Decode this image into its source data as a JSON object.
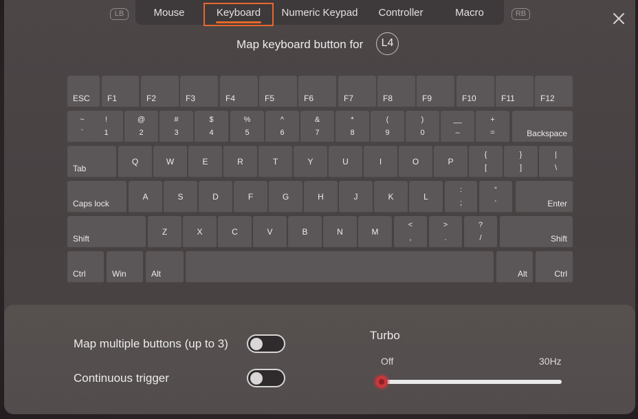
{
  "tabs": {
    "left_bumper": "LB",
    "right_bumper": "RB",
    "items": [
      {
        "label": "Mouse",
        "active": false
      },
      {
        "label": "Keyboard",
        "active": true
      },
      {
        "label": "Numeric Keypad",
        "active": false
      },
      {
        "label": "Controller",
        "active": false
      },
      {
        "label": "Macro",
        "active": false
      }
    ]
  },
  "header": {
    "title": "Map keyboard button for",
    "target_button": "L4"
  },
  "keyboard": {
    "rows": [
      [
        {
          "id": "esc",
          "label": "ESC"
        },
        {
          "id": "f1",
          "label": "F1"
        },
        {
          "id": "f2",
          "label": "F2"
        },
        {
          "id": "f3",
          "label": "F3"
        },
        {
          "id": "f4",
          "label": "F4"
        },
        {
          "id": "f5",
          "label": "F5"
        },
        {
          "id": "f6",
          "label": "F6"
        },
        {
          "id": "f7",
          "label": "F7"
        },
        {
          "id": "f8",
          "label": "F8"
        },
        {
          "id": "f9",
          "label": "F9"
        },
        {
          "id": "f10",
          "label": "F10"
        },
        {
          "id": "f11",
          "label": "F11"
        },
        {
          "id": "f12",
          "label": "F12"
        }
      ],
      [
        {
          "id": "grave",
          "top": "~",
          "bottom": "`"
        },
        {
          "id": "1",
          "top": "!",
          "bottom": "1"
        },
        {
          "id": "2",
          "top": "@",
          "bottom": "2"
        },
        {
          "id": "3",
          "top": "#",
          "bottom": "3"
        },
        {
          "id": "4",
          "top": "$",
          "bottom": "4"
        },
        {
          "id": "5",
          "top": "%",
          "bottom": "5"
        },
        {
          "id": "6",
          "top": "^",
          "bottom": "6"
        },
        {
          "id": "7",
          "top": "&",
          "bottom": "7"
        },
        {
          "id": "8",
          "top": "*",
          "bottom": "8"
        },
        {
          "id": "9",
          "top": "(",
          "bottom": "9"
        },
        {
          "id": "0",
          "top": ")",
          "bottom": "0"
        },
        {
          "id": "minus",
          "top": "__",
          "bottom": "–"
        },
        {
          "id": "equals",
          "top": "+",
          "bottom": "="
        },
        {
          "id": "backspace",
          "label": "Backspace"
        }
      ],
      [
        {
          "id": "tab",
          "label": "Tab"
        },
        {
          "id": "q",
          "label": "Q"
        },
        {
          "id": "w",
          "label": "W"
        },
        {
          "id": "e",
          "label": "E"
        },
        {
          "id": "r",
          "label": "R"
        },
        {
          "id": "t",
          "label": "T"
        },
        {
          "id": "y",
          "label": "Y"
        },
        {
          "id": "u",
          "label": "U"
        },
        {
          "id": "i",
          "label": "I"
        },
        {
          "id": "o",
          "label": "O"
        },
        {
          "id": "p",
          "label": "P"
        },
        {
          "id": "lbracket",
          "top": "{",
          "bottom": "["
        },
        {
          "id": "rbracket",
          "top": "}",
          "bottom": "]"
        },
        {
          "id": "backslash",
          "top": "|",
          "bottom": "\\"
        }
      ],
      [
        {
          "id": "capslock",
          "label": "Caps lock"
        },
        {
          "id": "a",
          "label": "A"
        },
        {
          "id": "s",
          "label": "S"
        },
        {
          "id": "d",
          "label": "D"
        },
        {
          "id": "f",
          "label": "F"
        },
        {
          "id": "g",
          "label": "G"
        },
        {
          "id": "h",
          "label": "H"
        },
        {
          "id": "j",
          "label": "J"
        },
        {
          "id": "k",
          "label": "K"
        },
        {
          "id": "l",
          "label": "L"
        },
        {
          "id": "semicolon",
          "top": ":",
          "bottom": ";"
        },
        {
          "id": "quote",
          "top": "“",
          "bottom": "‘"
        },
        {
          "id": "enter",
          "label": "Enter"
        }
      ],
      [
        {
          "id": "lshift",
          "label": "Shift"
        },
        {
          "id": "z",
          "label": "Z"
        },
        {
          "id": "x",
          "label": "X"
        },
        {
          "id": "c",
          "label": "C"
        },
        {
          "id": "v",
          "label": "V"
        },
        {
          "id": "b",
          "label": "B"
        },
        {
          "id": "n",
          "label": "N"
        },
        {
          "id": "m",
          "label": "M"
        },
        {
          "id": "comma",
          "top": "<",
          "bottom": ","
        },
        {
          "id": "period",
          "top": ">",
          "bottom": "."
        },
        {
          "id": "slash",
          "top": "?",
          "bottom": "/"
        },
        {
          "id": "rshift",
          "label": "Shift"
        }
      ],
      [
        {
          "id": "lctrl",
          "label": "Ctrl"
        },
        {
          "id": "win",
          "label": "Win"
        },
        {
          "id": "lalt",
          "label": "Alt"
        },
        {
          "id": "space",
          "label": ""
        },
        {
          "id": "ralt",
          "label": "Alt"
        },
        {
          "id": "rctrl",
          "label": "Ctrl"
        }
      ]
    ]
  },
  "settings": {
    "map_multiple": {
      "label": "Map multiple buttons (up to 3)",
      "on": false
    },
    "continuous_trigger": {
      "label": "Continuous trigger",
      "on": false
    },
    "turbo": {
      "title": "Turbo",
      "min_label": "Off",
      "max_label": "30Hz",
      "value_fraction": 0
    }
  },
  "colors": {
    "accent_tab": "#e8682c",
    "slider_thumb": "#c7373b"
  }
}
